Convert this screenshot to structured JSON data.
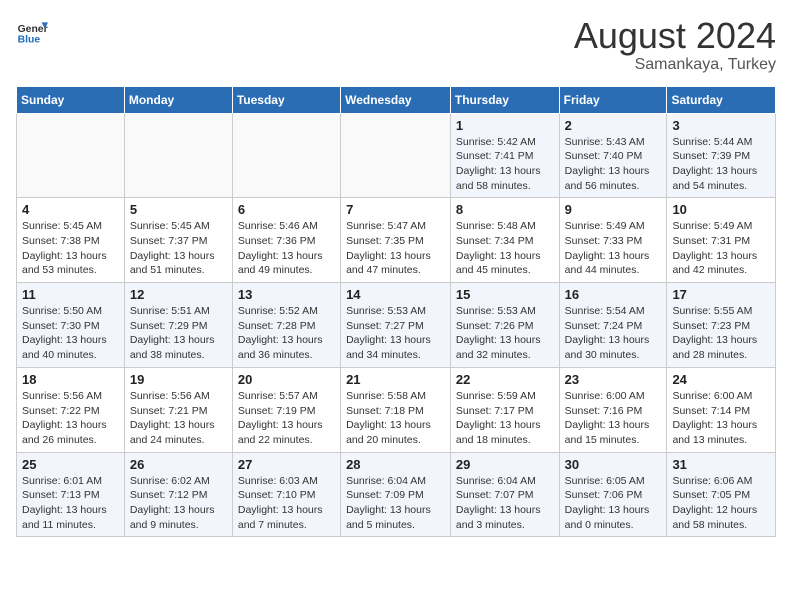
{
  "header": {
    "logo_general": "General",
    "logo_blue": "Blue",
    "month_year": "August 2024",
    "location": "Samankaya, Turkey"
  },
  "days_of_week": [
    "Sunday",
    "Monday",
    "Tuesday",
    "Wednesday",
    "Thursday",
    "Friday",
    "Saturday"
  ],
  "weeks": [
    [
      {
        "day": "",
        "info": ""
      },
      {
        "day": "",
        "info": ""
      },
      {
        "day": "",
        "info": ""
      },
      {
        "day": "",
        "info": ""
      },
      {
        "day": "1",
        "info": "Sunrise: 5:42 AM\nSunset: 7:41 PM\nDaylight: 13 hours\nand 58 minutes."
      },
      {
        "day": "2",
        "info": "Sunrise: 5:43 AM\nSunset: 7:40 PM\nDaylight: 13 hours\nand 56 minutes."
      },
      {
        "day": "3",
        "info": "Sunrise: 5:44 AM\nSunset: 7:39 PM\nDaylight: 13 hours\nand 54 minutes."
      }
    ],
    [
      {
        "day": "4",
        "info": "Sunrise: 5:45 AM\nSunset: 7:38 PM\nDaylight: 13 hours\nand 53 minutes."
      },
      {
        "day": "5",
        "info": "Sunrise: 5:45 AM\nSunset: 7:37 PM\nDaylight: 13 hours\nand 51 minutes."
      },
      {
        "day": "6",
        "info": "Sunrise: 5:46 AM\nSunset: 7:36 PM\nDaylight: 13 hours\nand 49 minutes."
      },
      {
        "day": "7",
        "info": "Sunrise: 5:47 AM\nSunset: 7:35 PM\nDaylight: 13 hours\nand 47 minutes."
      },
      {
        "day": "8",
        "info": "Sunrise: 5:48 AM\nSunset: 7:34 PM\nDaylight: 13 hours\nand 45 minutes."
      },
      {
        "day": "9",
        "info": "Sunrise: 5:49 AM\nSunset: 7:33 PM\nDaylight: 13 hours\nand 44 minutes."
      },
      {
        "day": "10",
        "info": "Sunrise: 5:49 AM\nSunset: 7:31 PM\nDaylight: 13 hours\nand 42 minutes."
      }
    ],
    [
      {
        "day": "11",
        "info": "Sunrise: 5:50 AM\nSunset: 7:30 PM\nDaylight: 13 hours\nand 40 minutes."
      },
      {
        "day": "12",
        "info": "Sunrise: 5:51 AM\nSunset: 7:29 PM\nDaylight: 13 hours\nand 38 minutes."
      },
      {
        "day": "13",
        "info": "Sunrise: 5:52 AM\nSunset: 7:28 PM\nDaylight: 13 hours\nand 36 minutes."
      },
      {
        "day": "14",
        "info": "Sunrise: 5:53 AM\nSunset: 7:27 PM\nDaylight: 13 hours\nand 34 minutes."
      },
      {
        "day": "15",
        "info": "Sunrise: 5:53 AM\nSunset: 7:26 PM\nDaylight: 13 hours\nand 32 minutes."
      },
      {
        "day": "16",
        "info": "Sunrise: 5:54 AM\nSunset: 7:24 PM\nDaylight: 13 hours\nand 30 minutes."
      },
      {
        "day": "17",
        "info": "Sunrise: 5:55 AM\nSunset: 7:23 PM\nDaylight: 13 hours\nand 28 minutes."
      }
    ],
    [
      {
        "day": "18",
        "info": "Sunrise: 5:56 AM\nSunset: 7:22 PM\nDaylight: 13 hours\nand 26 minutes."
      },
      {
        "day": "19",
        "info": "Sunrise: 5:56 AM\nSunset: 7:21 PM\nDaylight: 13 hours\nand 24 minutes."
      },
      {
        "day": "20",
        "info": "Sunrise: 5:57 AM\nSunset: 7:19 PM\nDaylight: 13 hours\nand 22 minutes."
      },
      {
        "day": "21",
        "info": "Sunrise: 5:58 AM\nSunset: 7:18 PM\nDaylight: 13 hours\nand 20 minutes."
      },
      {
        "day": "22",
        "info": "Sunrise: 5:59 AM\nSunset: 7:17 PM\nDaylight: 13 hours\nand 18 minutes."
      },
      {
        "day": "23",
        "info": "Sunrise: 6:00 AM\nSunset: 7:16 PM\nDaylight: 13 hours\nand 15 minutes."
      },
      {
        "day": "24",
        "info": "Sunrise: 6:00 AM\nSunset: 7:14 PM\nDaylight: 13 hours\nand 13 minutes."
      }
    ],
    [
      {
        "day": "25",
        "info": "Sunrise: 6:01 AM\nSunset: 7:13 PM\nDaylight: 13 hours\nand 11 minutes."
      },
      {
        "day": "26",
        "info": "Sunrise: 6:02 AM\nSunset: 7:12 PM\nDaylight: 13 hours\nand 9 minutes."
      },
      {
        "day": "27",
        "info": "Sunrise: 6:03 AM\nSunset: 7:10 PM\nDaylight: 13 hours\nand 7 minutes."
      },
      {
        "day": "28",
        "info": "Sunrise: 6:04 AM\nSunset: 7:09 PM\nDaylight: 13 hours\nand 5 minutes."
      },
      {
        "day": "29",
        "info": "Sunrise: 6:04 AM\nSunset: 7:07 PM\nDaylight: 13 hours\nand 3 minutes."
      },
      {
        "day": "30",
        "info": "Sunrise: 6:05 AM\nSunset: 7:06 PM\nDaylight: 13 hours\nand 0 minutes."
      },
      {
        "day": "31",
        "info": "Sunrise: 6:06 AM\nSunset: 7:05 PM\nDaylight: 12 hours\nand 58 minutes."
      }
    ]
  ]
}
